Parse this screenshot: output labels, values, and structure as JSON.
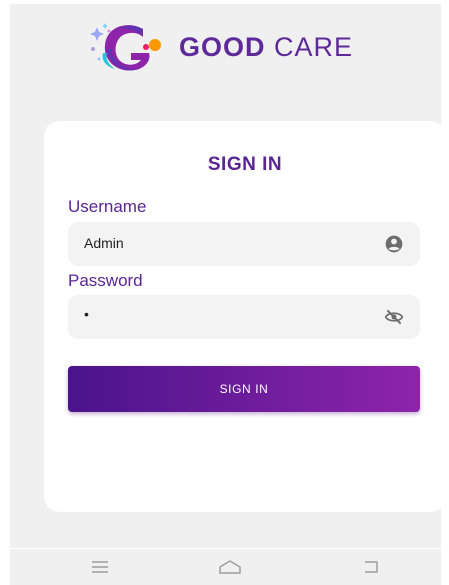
{
  "brand": {
    "word1": "GOOD",
    "word2": "CARE",
    "color": "#5e2a9a"
  },
  "login": {
    "title": "SIGN IN",
    "username_label": "Username",
    "username_value": "Admin",
    "password_label": "Password",
    "password_value": "•",
    "button_label": "SIGN IN"
  },
  "icons": {
    "username": "user-circle-icon",
    "password": "eye-slash-icon",
    "nav": [
      "menu-icon",
      "home-icon",
      "back-icon"
    ]
  },
  "colors": {
    "primary": "#5b2592",
    "button_start": "#4a148c",
    "button_end": "#8e24aa",
    "background": "#f0f0f0"
  }
}
